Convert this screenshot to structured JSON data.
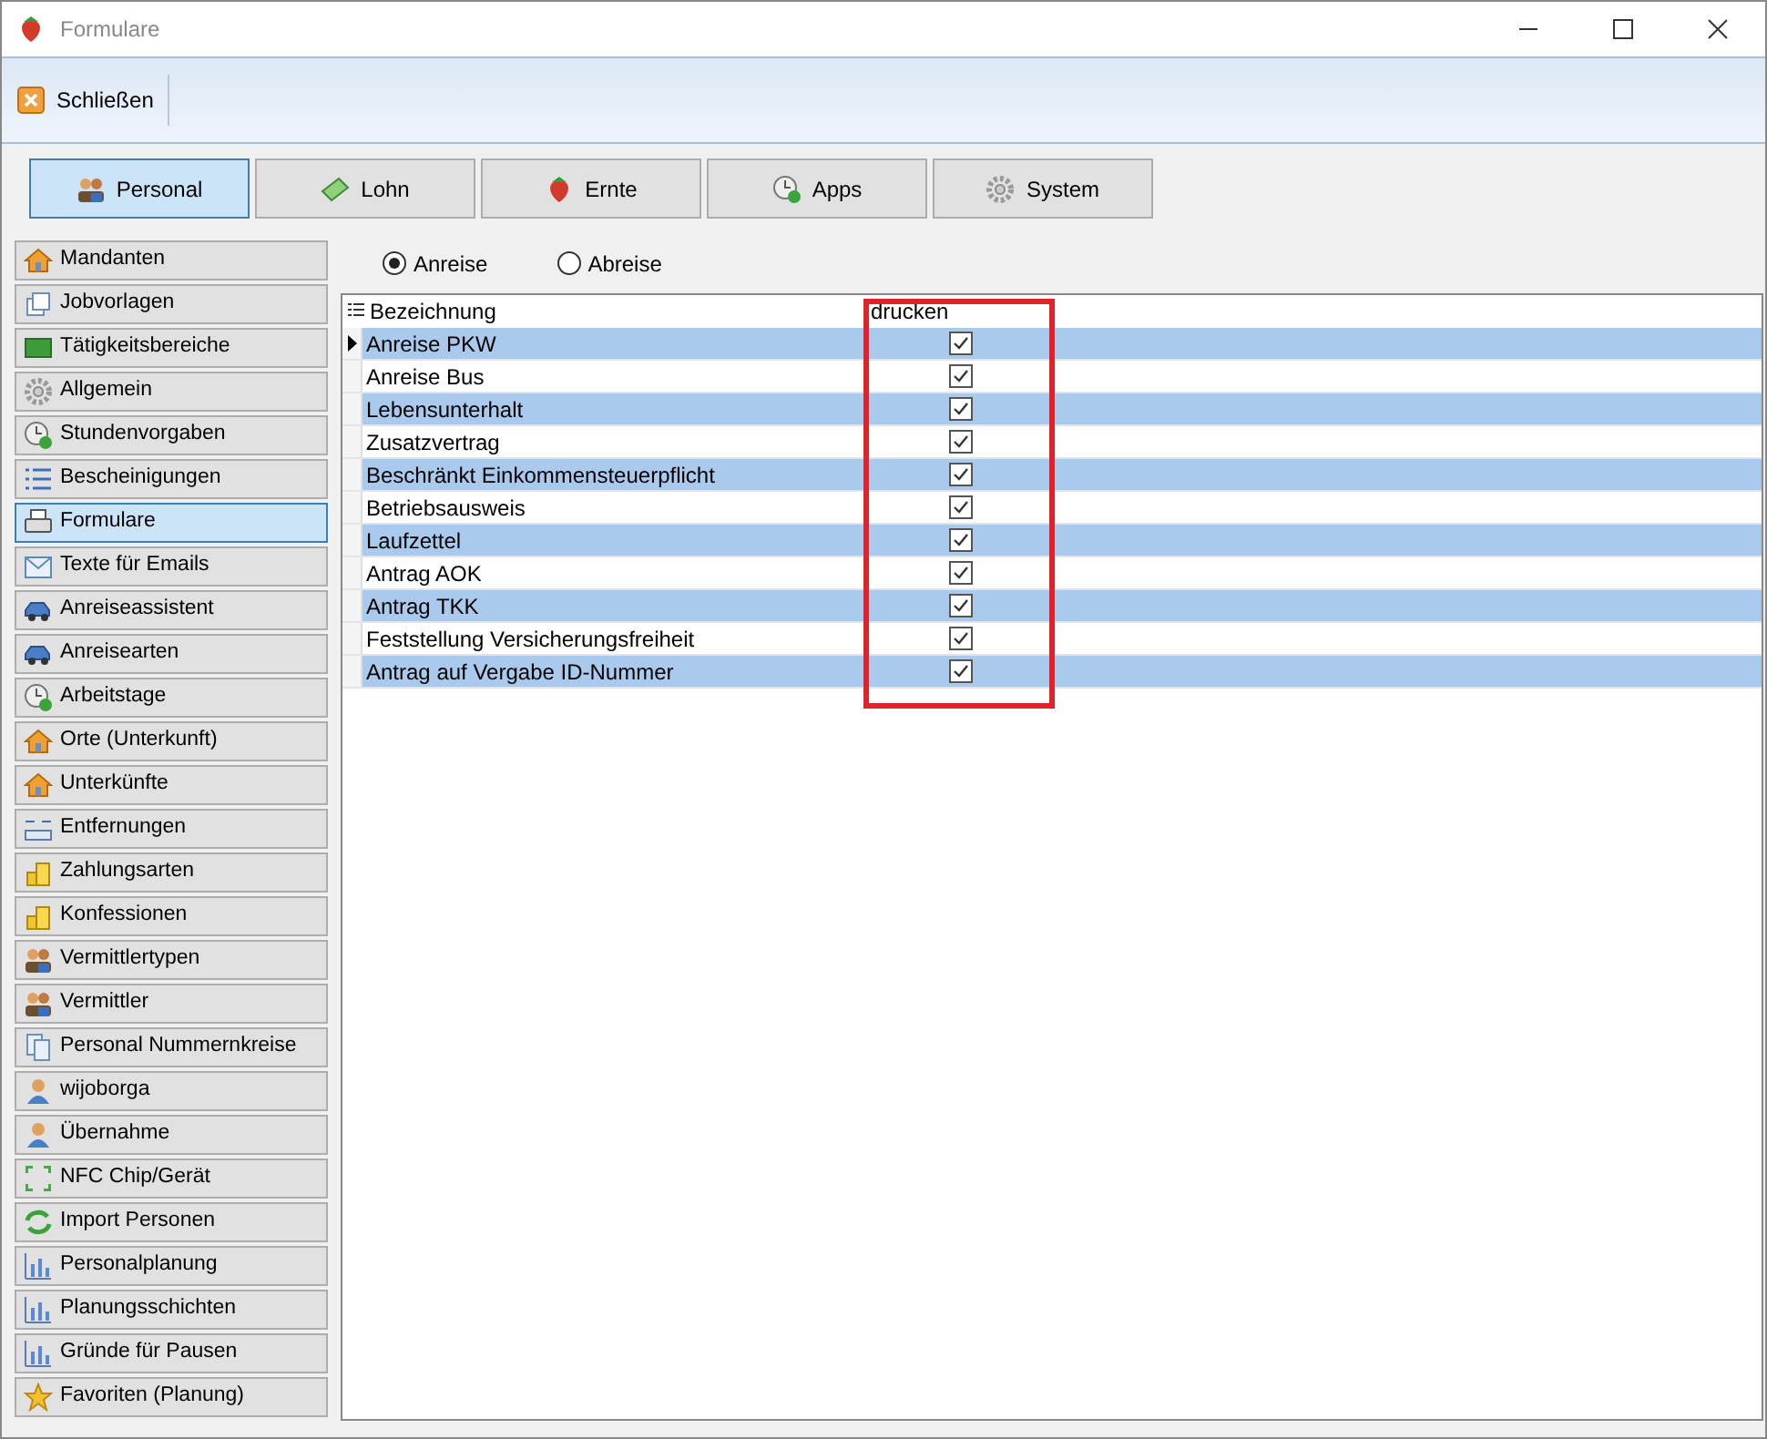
{
  "window": {
    "title": "Formulare"
  },
  "toolbar": {
    "buttons": [
      {
        "label": "Schließen"
      }
    ]
  },
  "tabs": [
    {
      "label": "Personal",
      "selected": true
    },
    {
      "label": "Lohn",
      "selected": false
    },
    {
      "label": "Ernte",
      "selected": false
    },
    {
      "label": "Apps",
      "selected": false
    },
    {
      "label": "System",
      "selected": false
    }
  ],
  "sidebar": {
    "items": [
      {
        "label": "Mandanten",
        "selected": false
      },
      {
        "label": "Jobvorlagen",
        "selected": false
      },
      {
        "label": "Tätigkeitsbereiche",
        "selected": false
      },
      {
        "label": "Allgemein",
        "selected": false
      },
      {
        "label": "Stundenvorgaben",
        "selected": false
      },
      {
        "label": "Bescheinigungen",
        "selected": false
      },
      {
        "label": "Formulare",
        "selected": true
      },
      {
        "label": "Texte für Emails",
        "selected": false
      },
      {
        "label": "Anreiseassistent",
        "selected": false
      },
      {
        "label": "Anreisearten",
        "selected": false
      },
      {
        "label": "Arbeitstage",
        "selected": false
      },
      {
        "label": "Orte (Unterkunft)",
        "selected": false
      },
      {
        "label": "Unterkünfte",
        "selected": false
      },
      {
        "label": "Entfernungen",
        "selected": false
      },
      {
        "label": "Zahlungsarten",
        "selected": false
      },
      {
        "label": "Konfessionen",
        "selected": false
      },
      {
        "label": "Vermittlertypen",
        "selected": false
      },
      {
        "label": "Vermittler",
        "selected": false
      },
      {
        "label": "Personal Nummernkreise",
        "selected": false
      },
      {
        "label": "wijoborga",
        "selected": false
      },
      {
        "label": "Übernahme",
        "selected": false
      },
      {
        "label": "NFC Chip/Gerät",
        "selected": false
      },
      {
        "label": "Import Personen",
        "selected": false
      },
      {
        "label": "Personalplanung",
        "selected": false
      },
      {
        "label": "Planungsschichten",
        "selected": false
      },
      {
        "label": "Gründe für Pausen",
        "selected": false
      },
      {
        "label": "Favoriten (Planung)",
        "selected": false
      }
    ]
  },
  "radios": [
    {
      "label": "Anreise",
      "selected": true
    },
    {
      "label": "Abreise",
      "selected": false
    }
  ],
  "table": {
    "columns": [
      "Bezeichnung",
      "drucken"
    ],
    "highlight_print_column": true,
    "rows": [
      {
        "name": "Anreise PKW",
        "print": true,
        "current": true
      },
      {
        "name": "Anreise Bus",
        "print": true,
        "current": false
      },
      {
        "name": "Lebensunterhalt",
        "print": true,
        "current": false
      },
      {
        "name": "Zusatzvertrag",
        "print": true,
        "current": false
      },
      {
        "name": "Beschränkt Einkommensteuerpflicht",
        "print": true,
        "current": false
      },
      {
        "name": "Betriebsausweis",
        "print": true,
        "current": false
      },
      {
        "name": "Laufzettel",
        "print": true,
        "current": false
      },
      {
        "name": "Antrag AOK",
        "print": true,
        "current": false
      },
      {
        "name": "Antrag TKK",
        "print": true,
        "current": false
      },
      {
        "name": "Feststellung Versicherungsfreiheit",
        "print": true,
        "current": false
      },
      {
        "name": "Antrag auf Vergabe ID-Nummer",
        "print": true,
        "current": false
      }
    ]
  }
}
